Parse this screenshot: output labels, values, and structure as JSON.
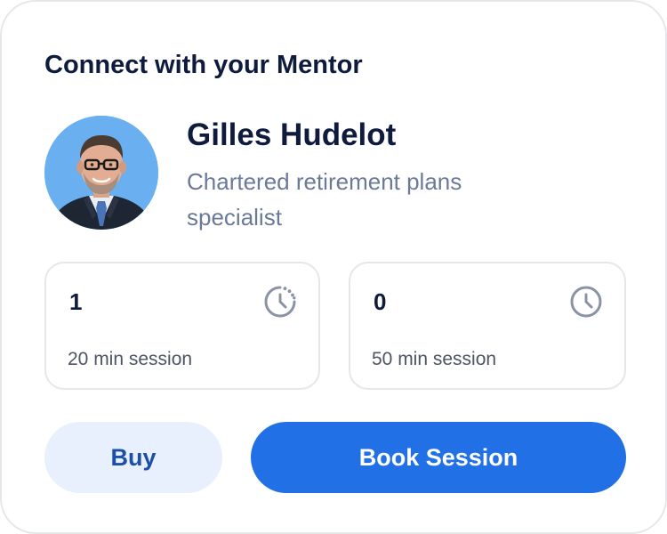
{
  "card": {
    "title": "Connect with your Mentor"
  },
  "mentor": {
    "name": "Gilles Hudelot",
    "role": "Chartered retirement plans specialist",
    "avatar_icon": "mentor-avatar-photo"
  },
  "sessions": [
    {
      "count": "1",
      "label": "20 min session",
      "icon": "clock-dotted-icon"
    },
    {
      "count": "0",
      "label": "50 min session",
      "icon": "clock-icon"
    }
  ],
  "actions": {
    "buy_label": "Buy",
    "book_label": "Book Session"
  },
  "colors": {
    "primary": "#2170e6",
    "primary_soft": "#e8f0fd",
    "heading": "#0f1b3d",
    "muted": "#6b7a99",
    "border": "#e5e7eb",
    "icon": "#8a93a6"
  }
}
